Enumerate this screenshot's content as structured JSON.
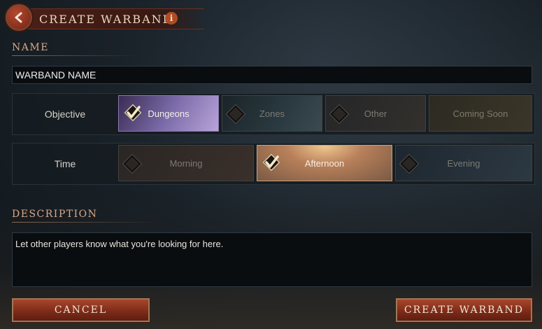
{
  "header": {
    "title": "CREATE WARBAND",
    "info_glyph": "i",
    "back_icon": "chevron-left-icon"
  },
  "name_section": {
    "label": "NAME",
    "input_value": "WARBAND NAME"
  },
  "objective": {
    "label": "Objective",
    "options": [
      {
        "label": "Dungeons",
        "selected": true
      },
      {
        "label": "Zones",
        "selected": false
      },
      {
        "label": "Other",
        "selected": false
      },
      {
        "label": "Coming Soon",
        "selected": false
      }
    ]
  },
  "time": {
    "label": "Time",
    "options": [
      {
        "label": "Morning",
        "selected": false
      },
      {
        "label": "Afternoon",
        "selected": true
      },
      {
        "label": "Evening",
        "selected": false
      }
    ]
  },
  "description_section": {
    "label": "DESCRIPTION",
    "text": "Let other players know what you're looking for here."
  },
  "buttons": {
    "cancel": "CANCEL",
    "create": "CREATE WARBAND"
  },
  "colors": {
    "accent_red": "#a8452c",
    "label_tan": "#d9a98a",
    "selected_purple": "#7a6aa8",
    "selected_gold": "#b8805a"
  }
}
